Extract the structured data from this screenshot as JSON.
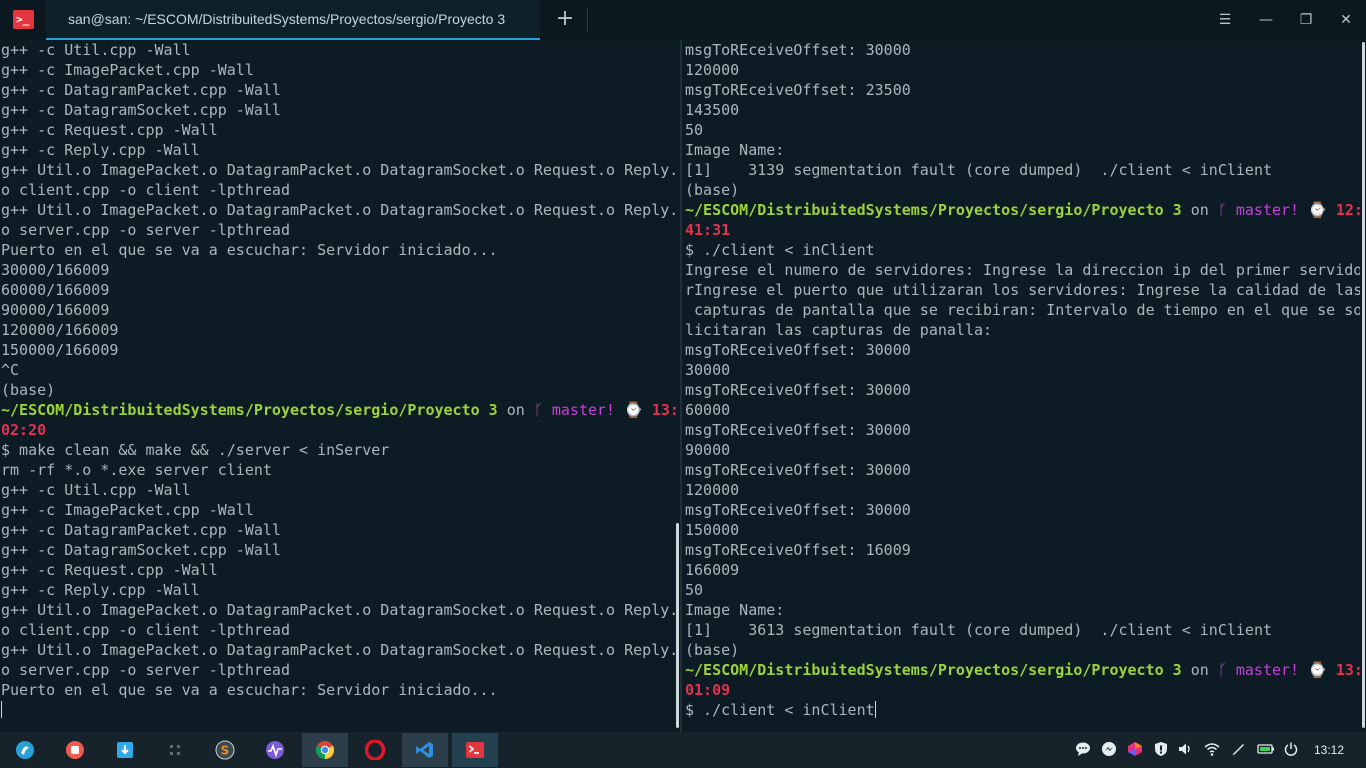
{
  "window": {
    "tab_title": "san@san: ~/ESCOM/DistribuitedSystems/Proyectos/sergio/Proyecto 3",
    "new_tab_glyph": "+",
    "menu_glyph": "☰",
    "minimize_glyph": "—",
    "maximize_glyph": "❐",
    "close_glyph": "✕",
    "app_icon_glyph": ">_",
    "accent": "#2aa1d6"
  },
  "left_pane": {
    "lines_top": [
      "g++ -c Util.cpp -Wall",
      "g++ -c ImagePacket.cpp -Wall",
      "g++ -c DatagramPacket.cpp -Wall",
      "g++ -c DatagramSocket.cpp -Wall",
      "g++ -c Request.cpp -Wall",
      "g++ -c Reply.cpp -Wall",
      "g++ Util.o ImagePacket.o DatagramPacket.o DatagramSocket.o Request.o Reply.",
      "o client.cpp -o client -lpthread",
      "g++ Util.o ImagePacket.o DatagramPacket.o DatagramSocket.o Request.o Reply.",
      "o server.cpp -o server -lpthread",
      "Puerto en el que se va a escuchar: Servidor iniciado...",
      "30000/166009",
      "60000/166009",
      "90000/166009",
      "120000/166009",
      "150000/166009",
      "^C",
      "(base)"
    ],
    "prompt": {
      "path": "~/ESCOM/DistribuitedSystems/Proyectos/sergio/Proyecto 3",
      "on": "on",
      "branch": "master!",
      "time_a": "13:",
      "time_b": "02:20"
    },
    "lines_bottom": [
      "$ make clean && make && ./server < inServer",
      "rm -rf *.o *.exe server client",
      "g++ -c Util.cpp -Wall",
      "g++ -c ImagePacket.cpp -Wall",
      "g++ -c DatagramPacket.cpp -Wall",
      "g++ -c DatagramSocket.cpp -Wall",
      "g++ -c Request.cpp -Wall",
      "g++ -c Reply.cpp -Wall",
      "g++ Util.o ImagePacket.o DatagramPacket.o DatagramSocket.o Request.o Reply.",
      "o client.cpp -o client -lpthread",
      "g++ Util.o ImagePacket.o DatagramPacket.o DatagramSocket.o Request.o Reply.",
      "o server.cpp -o server -lpthread",
      "Puerto en el que se va a escuchar: Servidor iniciado..."
    ]
  },
  "right_pane": {
    "lines_top": [
      "msgToREceiveOffset: 30000",
      "120000",
      "msgToREceiveOffset: 23500",
      "143500",
      "50",
      "Image Name:",
      "[1]    3139 segmentation fault (core dumped)  ./client < inClient",
      "(base)"
    ],
    "prompt1": {
      "path": "~/ESCOM/DistribuitedSystems/Proyectos/sergio/Proyecto 3",
      "on": "on",
      "branch": "master!",
      "time_a": "12:",
      "time_b": "41:31"
    },
    "lines_mid": [
      "$ ./client < inClient",
      "Ingrese el numero de servidores: Ingrese la direccion ip del primer servido",
      "rIngrese el puerto que utilizaran los servidores: Ingrese la calidad de las",
      " capturas de pantalla que se recibiran: Intervalo de tiempo en el que se so",
      "licitaran las capturas de panalla:",
      "msgToREceiveOffset: 30000",
      "30000",
      "msgToREceiveOffset: 30000",
      "60000",
      "msgToREceiveOffset: 30000",
      "90000",
      "msgToREceiveOffset: 30000",
      "120000",
      "msgToREceiveOffset: 30000",
      "150000",
      "msgToREceiveOffset: 16009",
      "166009",
      "50",
      "Image Name:",
      "[1]    3613 segmentation fault (core dumped)  ./client < inClient",
      "(base)"
    ],
    "prompt2": {
      "path": "~/ESCOM/DistribuitedSystems/Proyectos/sergio/Proyecto 3",
      "on": "on",
      "branch": "master!",
      "time_a": "13:",
      "time_b": "01:09"
    },
    "last_command": "$ ./client < inClient"
  },
  "taskbar": {
    "clock": "13:12",
    "apps": [
      "launcher",
      "screen-recorder",
      "app-store",
      "workspace-grid",
      "sublime-text",
      "system-monitor",
      "chrome",
      "opera",
      "vscode",
      "terminal"
    ],
    "colors": {
      "launcher": "#2aa1d6",
      "recorder": "#f05a4f",
      "store": "#31a8e8",
      "sublime": "#f28b1d",
      "monitor": "#7b5cd6",
      "opera": "#e0162b",
      "vscode": "#2f8ee0",
      "terminal": "#e3363f"
    }
  }
}
